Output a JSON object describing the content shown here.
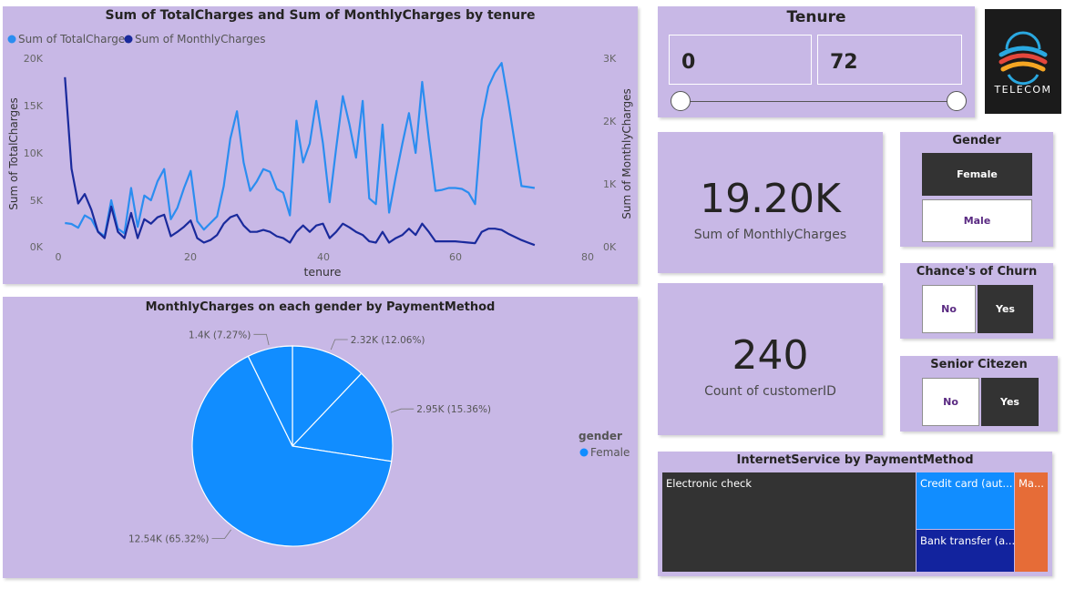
{
  "line_chart": {
    "title": "Sum of TotalCharges and Sum of MonthlyCharges by tenure",
    "legend": [
      "Sum of TotalCharges",
      "Sum of MonthlyCharges"
    ],
    "xlabel": "tenure",
    "ylabel_left": "Sum of TotalCharges",
    "ylabel_right": "Sum of MonthlyCharges",
    "x_ticks": [
      "0",
      "20",
      "40",
      "60",
      "80"
    ],
    "y_left_ticks": [
      "20K",
      "15K",
      "10K",
      "5K",
      "0K"
    ],
    "y_right_ticks": [
      "3K",
      "2K",
      "1K",
      "0K"
    ]
  },
  "pie_chart": {
    "title": "MonthlyCharges on each gender by PaymentMethod",
    "legend_title": "gender",
    "legend_item": "Female",
    "labels": [
      "2.32K (12.06%)",
      "2.95K (15.36%)",
      "12.54K (65.32%)",
      "1.4K (7.27%)"
    ]
  },
  "tenure_slicer": {
    "title": "Tenure",
    "min_value": "0",
    "max_value": "72"
  },
  "logo": {
    "text": "TELECOM"
  },
  "kpi_monthly": {
    "value": "19.20K",
    "label": "Sum of MonthlyCharges"
  },
  "kpi_count": {
    "value": "240",
    "label": "Count of customerID"
  },
  "gender_slicer": {
    "title": "Gender",
    "options": [
      "Female",
      "Male"
    ]
  },
  "churn_slicer": {
    "title": "Chance's of Churn",
    "options": [
      "No",
      "Yes"
    ]
  },
  "senior_slicer": {
    "title": "Senior Citezen",
    "options": [
      "No",
      "Yes"
    ]
  },
  "treemap": {
    "title": "InternetService by PaymentMethod",
    "tiles": [
      "Electronic check",
      "Credit card (aut...",
      "Bank transfer (a...",
      "Ma..."
    ]
  },
  "colors": {
    "card_bg": "#c8b8e6",
    "series_total": "#2b8df0",
    "series_monthly": "#1a2a9c",
    "pie": "#118dff",
    "selected": "#333333",
    "treemap_electronic": "#333333",
    "treemap_credit": "#118dff",
    "treemap_bank": "#12239e",
    "treemap_mailed": "#e66c37"
  },
  "chart_data": [
    {
      "type": "line",
      "title": "Sum of TotalCharges and Sum of MonthlyCharges by tenure",
      "xlabel": "tenure",
      "xlim": [
        0,
        80
      ],
      "series": [
        {
          "name": "Sum of TotalCharges",
          "axis": "left",
          "ylim": [
            0,
            20000
          ],
          "x": [
            1,
            2,
            3,
            4,
            5,
            6,
            7,
            8,
            9,
            10,
            11,
            12,
            13,
            14,
            15,
            16,
            17,
            18,
            19,
            20,
            21,
            22,
            23,
            24,
            25,
            26,
            27,
            28,
            29,
            30,
            31,
            32,
            33,
            34,
            35,
            36,
            37,
            38,
            39,
            40,
            41,
            42,
            43,
            44,
            45,
            46,
            47,
            48,
            49,
            50,
            51,
            52,
            53,
            54,
            55,
            56,
            57,
            58,
            59,
            60,
            61,
            62,
            63,
            64,
            65,
            66,
            67,
            68,
            69,
            70,
            71,
            72
          ],
          "values": [
            2600,
            2500,
            2100,
            3400,
            3000,
            1700,
            1200,
            5000,
            2000,
            1500,
            6300,
            2200,
            5500,
            5000,
            7000,
            8300,
            3000,
            4200,
            6300,
            8100,
            2800,
            1900,
            2600,
            3300,
            6500,
            11500,
            14400,
            9000,
            6000,
            7000,
            8300,
            8000,
            6200,
            5800,
            3400,
            13400,
            9000,
            11000,
            15500,
            11000,
            4800,
            10500,
            16000,
            13000,
            9500,
            15500,
            5200,
            4600,
            13000,
            3700,
            7500,
            11000,
            14200,
            10000,
            17500,
            11500,
            6000,
            6100,
            6300,
            6300,
            6200,
            5800,
            4600,
            13500,
            17000,
            18500,
            19500,
            15500,
            11000,
            6500,
            6400,
            6300
          ]
        },
        {
          "name": "Sum of MonthlyCharges",
          "axis": "right",
          "ylim": [
            0,
            3000
          ],
          "x": [
            1,
            2,
            3,
            4,
            5,
            6,
            7,
            8,
            9,
            10,
            11,
            12,
            13,
            14,
            15,
            16,
            17,
            18,
            19,
            20,
            21,
            22,
            23,
            24,
            25,
            26,
            27,
            28,
            29,
            30,
            31,
            32,
            33,
            34,
            35,
            36,
            37,
            38,
            39,
            40,
            41,
            42,
            43,
            44,
            45,
            46,
            47,
            48,
            49,
            50,
            51,
            52,
            53,
            54,
            55,
            56,
            57,
            58,
            59,
            60,
            61,
            62,
            63,
            64,
            65,
            66,
            67,
            68,
            69,
            70,
            71,
            72
          ],
          "values": [
            2700,
            1250,
            700,
            850,
            600,
            250,
            150,
            650,
            250,
            150,
            550,
            150,
            450,
            380,
            480,
            520,
            180,
            250,
            330,
            430,
            150,
            80,
            120,
            200,
            380,
            480,
            520,
            350,
            250,
            250,
            280,
            250,
            180,
            150,
            80,
            250,
            350,
            250,
            350,
            380,
            150,
            250,
            380,
            320,
            250,
            200,
            100,
            80,
            250,
            80,
            150,
            200,
            300,
            200,
            380,
            250,
            100,
            100,
            100,
            100,
            90,
            80,
            70,
            250,
            300,
            300,
            280,
            220,
            170,
            120,
            80,
            40
          ]
        }
      ]
    },
    {
      "type": "pie",
      "title": "MonthlyCharges on each gender by PaymentMethod",
      "categories": [
        "2.32K (12.06%)",
        "2.95K (15.36%)",
        "12.54K (65.32%)",
        "1.4K (7.27%)"
      ],
      "values": [
        2320,
        2950,
        12540,
        1400
      ]
    },
    {
      "type": "treemap",
      "title": "InternetService by PaymentMethod",
      "categories": [
        "Electronic check",
        "Credit card (aut...",
        "Bank transfer (a...",
        "Ma..."
      ],
      "values": [
        0.635,
        0.148,
        0.132,
        0.085
      ]
    }
  ]
}
